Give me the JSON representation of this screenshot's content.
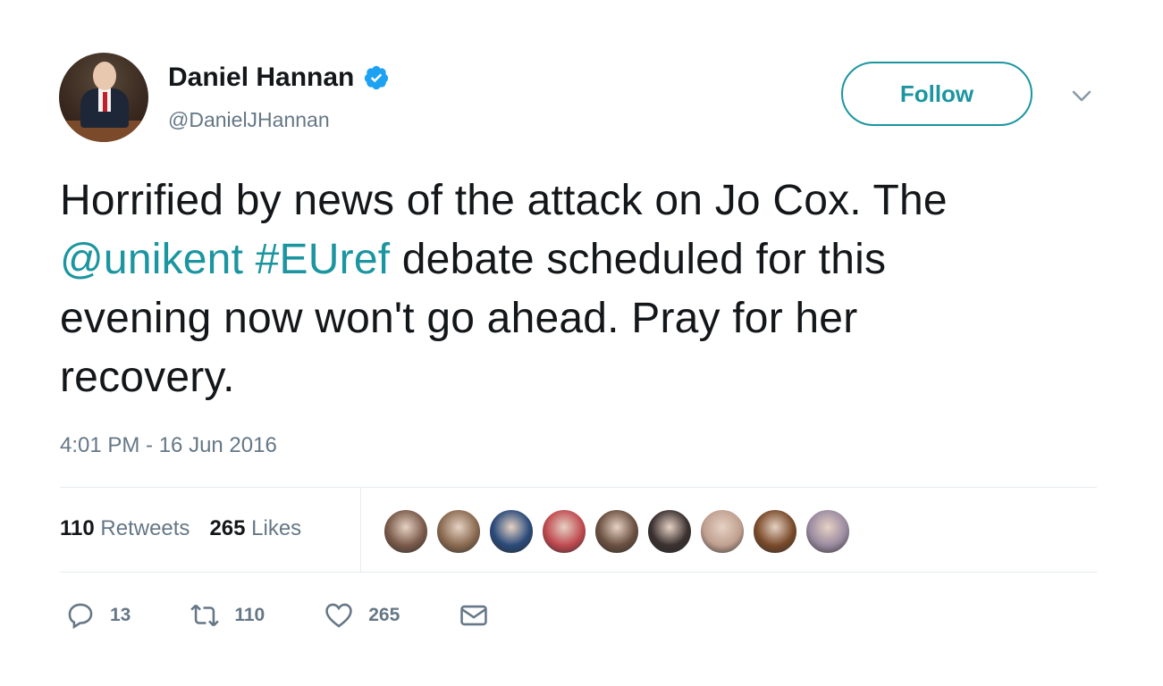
{
  "author": {
    "name": "Daniel Hannan",
    "handle": "@DanielJHannan",
    "verified": true
  },
  "follow_button": {
    "label": "Follow"
  },
  "tweet": {
    "line1": "Horrified by news of the attack on Jo Cox. The",
    "mention": "@unikent",
    "hashtag": "#EUref",
    "line2_rest": " debate scheduled for this",
    "line3": "evening now won't go ahead. Pray for her",
    "line4": "recovery."
  },
  "timestamp": "4:01 PM - 16 Jun 2016",
  "stats": {
    "retweets_count": "110",
    "retweets_label": "Retweets",
    "likes_count": "265",
    "likes_label": "Likes"
  },
  "likers": [
    {
      "color": "#7a5a4a"
    },
    {
      "color": "#8a6a50"
    },
    {
      "color": "#2a4a7a"
    },
    {
      "color": "#c04a50"
    },
    {
      "color": "#6a5040"
    },
    {
      "color": "#3a3030"
    },
    {
      "color": "#c0a090"
    },
    {
      "color": "#7a4a2a"
    },
    {
      "color": "#9a8aa0"
    }
  ],
  "actions": {
    "reply_count": "13",
    "retweet_count": "110",
    "like_count": "265"
  },
  "colors": {
    "accent": "#1b95a0",
    "secondary_text": "#657786",
    "primary_text": "#14171a",
    "verified": "#1da1f2"
  },
  "icons": [
    "verified-badge-icon",
    "chevron-down-icon",
    "reply-icon",
    "retweet-icon",
    "heart-icon",
    "envelope-icon"
  ]
}
